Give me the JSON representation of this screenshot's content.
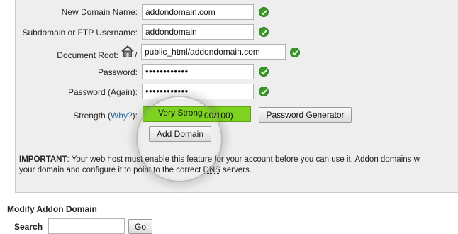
{
  "form": {
    "new_domain_label": "New Domain Name:",
    "new_domain_value": "addondomain.com",
    "subdomain_label": "Subdomain or FTP Username:",
    "subdomain_value": "addondomain",
    "docroot_label": "Document Root:",
    "docroot_prefix": "/",
    "docroot_value": "public_html/addondomain.com",
    "password_label": "Password:",
    "password_value": "••••••••••••",
    "password_again_label": "Password (Again):",
    "password_again_value": "••••••••••••",
    "strength_label_prefix": "Strength (",
    "strength_why_link": "Why?",
    "strength_label_suffix": "):",
    "strength_value": "Very Strong",
    "strength_score": "00/100)",
    "password_generator_button": "Password Generator",
    "add_domain_button": "Add Domain"
  },
  "notice": {
    "important_label": "IMPORTANT",
    "line1": ": Your web host must enable this feature for your account before you can use it. Addon domains w",
    "line2_a": "your domain and configure it to point to the correct ",
    "dns": "DNS",
    "line2_b": " servers."
  },
  "modify": {
    "title": "Modify Addon Domain",
    "search_label": "Search",
    "search_value": "",
    "go_button": "Go"
  },
  "colors": {
    "strength_bar": "#7ed321",
    "check_ok": "#3a9a28",
    "panel_bg": "#eeeeee",
    "link": "#2a6a9a"
  },
  "icons": {
    "status": "check-circle-icon",
    "docroot": "home-icon"
  }
}
